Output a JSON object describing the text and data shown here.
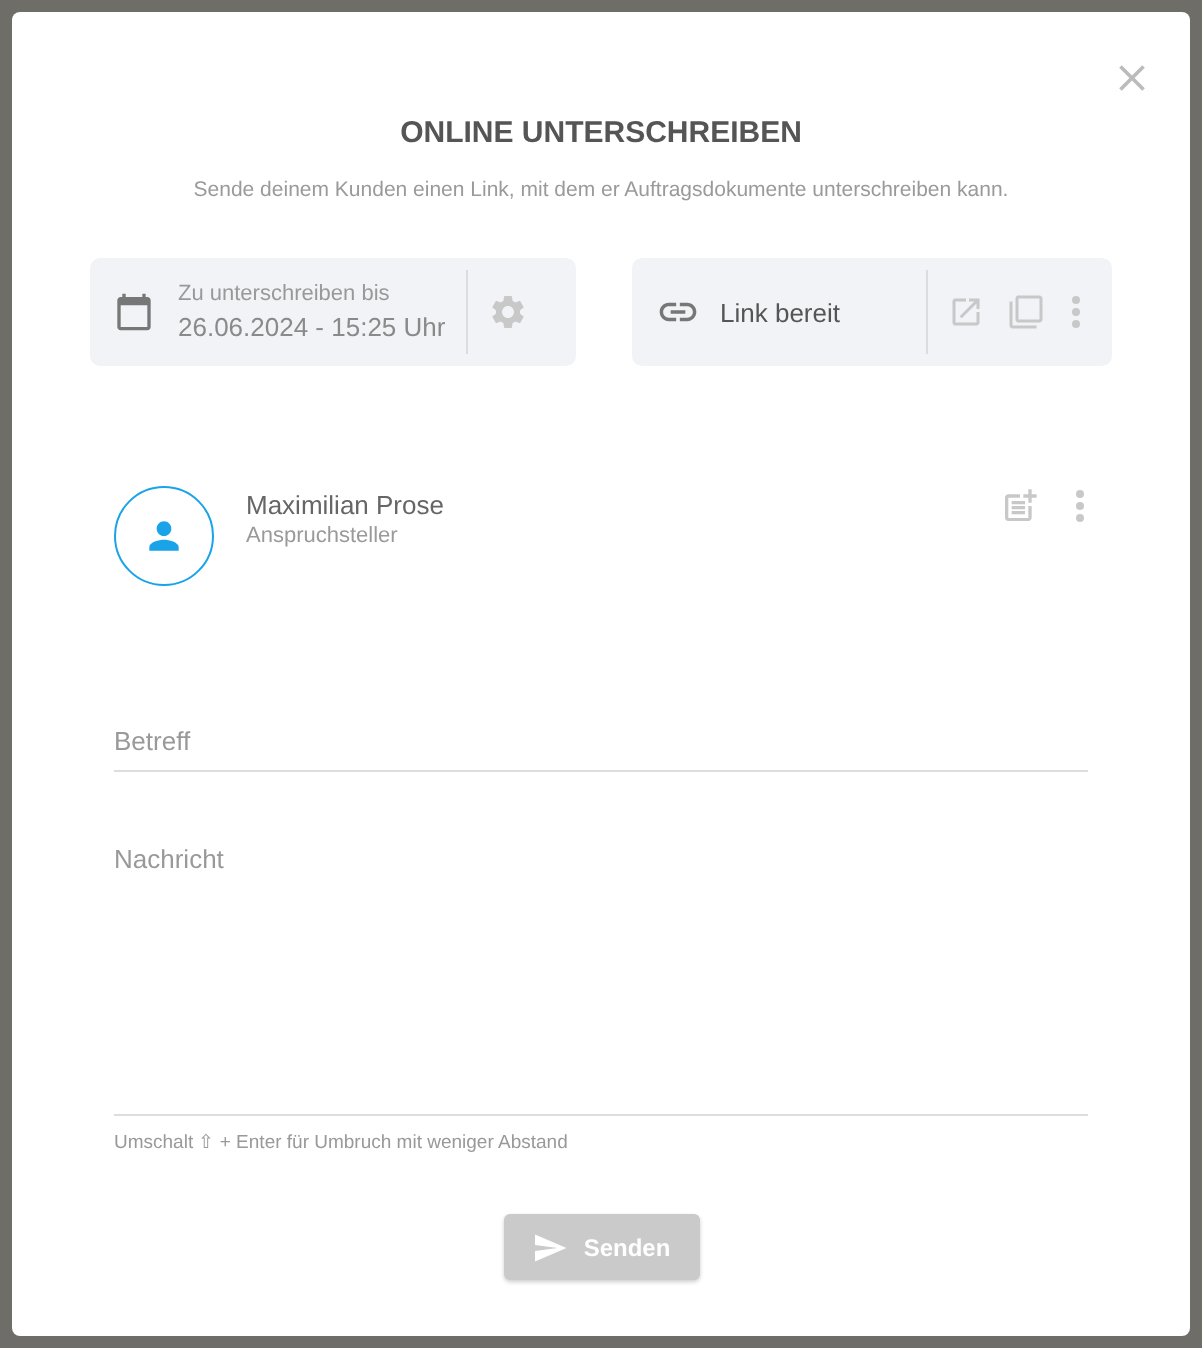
{
  "dialog": {
    "title": "ONLINE UNTERSCHREIBEN",
    "subtitle": "Sende deinem Kunden einen Link, mit dem er Auftragsdokumente unterschreiben kann."
  },
  "deadline": {
    "label": "Zu unterschreiben bis",
    "value": "26.06.2024 - 15:25 Uhr"
  },
  "link": {
    "label": "Link bereit"
  },
  "recipient": {
    "name": "Maximilian Prose",
    "role": "Anspruchsteller"
  },
  "subject": {
    "placeholder": "Betreff"
  },
  "message": {
    "placeholder": "Nachricht",
    "hint": "Umschalt ⇧ + Enter für Umbruch mit weniger Abstand"
  },
  "send": {
    "label": "Senden",
    "disabled": true
  }
}
